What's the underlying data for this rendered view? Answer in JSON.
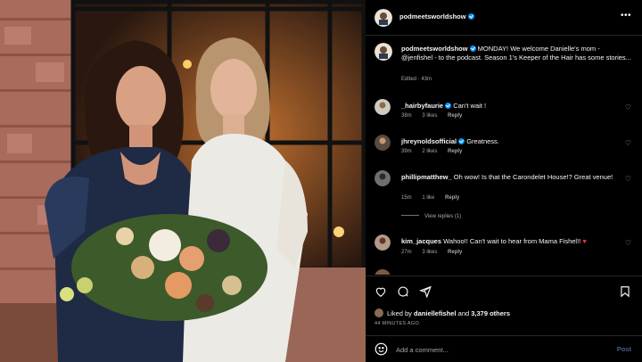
{
  "post": {
    "username": "podmeetsworldshow",
    "caption_text": " MONDAY! We welcome Danielle's mom - @jenfishel - to the podcast. Season 1's Keeper of the Hair has some stories...",
    "caption_meta": "Edited · 43m",
    "liked_by_prefix": "Liked by ",
    "liked_by_user": "daniellefishel",
    "liked_by_and": " and ",
    "liked_by_others": "3,379 others",
    "timestamp": "44 MINUTES AGO"
  },
  "comments": [
    {
      "user": "_hairbyfaurie",
      "verified": true,
      "text": "Can't wait !",
      "time": "38m",
      "likes": "3 likes",
      "reply": "Reply"
    },
    {
      "user": "jhreynoldsofficial",
      "verified": true,
      "text": "Greatness.",
      "time": "39m",
      "likes": "2 likes",
      "reply": "Reply"
    },
    {
      "user": "phillipmatthew_",
      "verified": false,
      "text": "Oh wow! Is that the Carondelet House!? Great venue!",
      "time": "15m",
      "likes": "1 like",
      "reply": "Reply"
    },
    {
      "user": "kim_jacques",
      "verified": false,
      "text": "Wahoo!! Can't wait to hear from Mama Fishel!! ",
      "time": "27m",
      "likes": "3 likes",
      "reply": "Reply"
    }
  ],
  "view_replies": "View replies (1)",
  "composer": {
    "placeholder": "Add a comment...",
    "post_label": "Post"
  },
  "icons": [
    "more-icon",
    "heart-icon",
    "comment-icon",
    "share-icon",
    "bookmark-icon",
    "emoji-icon",
    "verified-badge-icon"
  ],
  "colors": {
    "background": "#000000",
    "verified": "#0095f6",
    "muted": "#a8a8a8",
    "post_button": "#4a5d8a",
    "red_heart": "#ff3040"
  }
}
